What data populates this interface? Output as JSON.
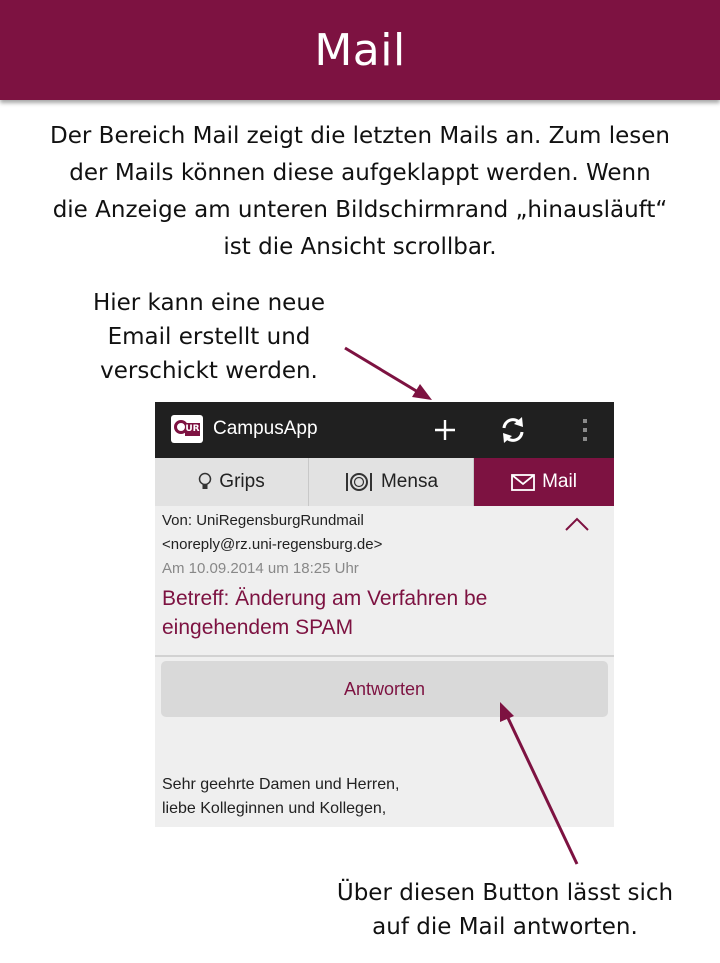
{
  "header": {
    "title": "Mail"
  },
  "intro": {
    "line1": "Der Bereich Mail zeigt die letzten Mails an. Zum lesen",
    "line2": "der Mails können diese aufgeklappt werden. Wenn",
    "line3": "die Anzeige am unteren Bildschirmrand „hinausläuft“",
    "line4": "ist die Ansicht scrollbar."
  },
  "callouts": {
    "new_mail": {
      "line1": "Hier kann eine neue",
      "line2": "Email erstellt und",
      "line3": "verschickt werden."
    },
    "reply": {
      "line1": "Über diesen Button lässt sich",
      "line2": "auf die Mail antworten."
    }
  },
  "app": {
    "logo_text": "UR",
    "title": "CampusApp",
    "actions": [
      "plus-icon",
      "refresh-icon",
      "overflow-menu-icon"
    ],
    "tabs": [
      {
        "label": "Grips",
        "icon": "lightbulb-icon",
        "selected": false
      },
      {
        "label": "Mensa",
        "icon": "plate-icon",
        "selected": false
      },
      {
        "label": "Mail",
        "icon": "envelope-icon",
        "selected": true
      }
    ],
    "mail": {
      "from_line1": "Von: UniRegensburgRundmail",
      "from_line2": "<noreply@rz.uni-regensburg.de>",
      "date": "Am 10.09.2014 um 18:25 Uhr",
      "subject_line1": "Betreff: Änderung am Verfahren be",
      "subject_line2": "eingehendem SPAM",
      "reply_label": "Antworten",
      "body_line1": "Sehr geehrte Damen und Herren,",
      "body_line2": "liebe Kolleginnen und Kollegen,"
    }
  },
  "colors": {
    "brand": "#7d1241",
    "action_bar": "#202020",
    "annotation_arrow": "#7d1241"
  }
}
